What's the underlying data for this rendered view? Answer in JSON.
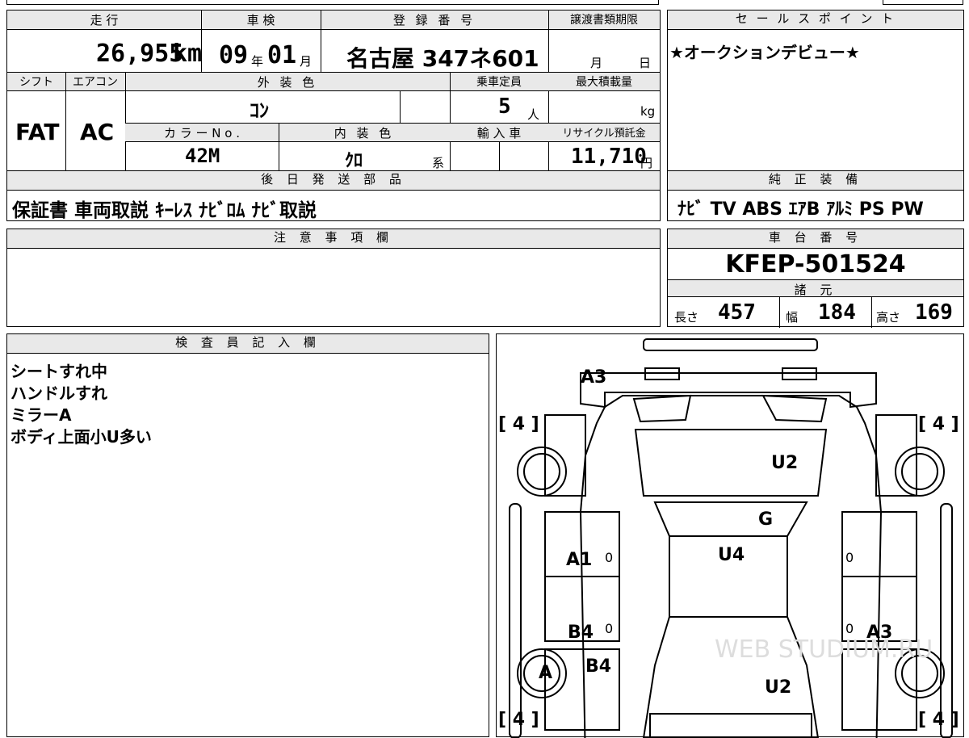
{
  "top_table": {
    "headers": {
      "mileage": "走 行",
      "inspection": "車 検",
      "registration": "登 録 番 号",
      "transfer_deadline": "譲渡書類期限",
      "shift": "シフト",
      "aircon": "エアコン",
      "exterior_color": "外 装 色",
      "capacity": "乗車定員",
      "max_load": "最大積載量",
      "color_no": "カ ラ ー N o .",
      "interior_color": "内 装 色",
      "import": "輸 入 車",
      "recycle_fee": "リサイクル預託金"
    },
    "mileage_value": "26,955",
    "mileage_unit": "km",
    "inspection_year": "09",
    "inspection_year_unit": "年",
    "inspection_month": "01",
    "inspection_month_unit": "月",
    "plate": "名古屋 347ネ601",
    "transfer_month_unit": "月",
    "transfer_day_unit": "日",
    "shift_value": "FAT",
    "aircon_value": "AC",
    "exterior_color_value": "ｺﾝ",
    "capacity_value": "5",
    "capacity_unit": "人",
    "max_load_unit": "kg",
    "color_no_value": "42M",
    "interior_color_value": "ｸﾛ",
    "interior_color_unit": "系",
    "recycle_fee_value": "11,710",
    "recycle_fee_unit": "円"
  },
  "sales_point": {
    "header": "セ ー ル ス ポ イ ン ト",
    "text": "★オークションデビュー★"
  },
  "later_parts": {
    "header": "後 日 発 送 部 品",
    "text": "保証書 車両取説 ｷｰﾚｽ ﾅﾋﾞﾛﾑ ﾅﾋﾞ取説"
  },
  "genuine_equipment": {
    "header": "純 正 装 備",
    "text": "ﾅﾋﾞ TV ABS ｴｱB ｱﾙﾐ PS PW"
  },
  "notes": {
    "header": "注 意 事 項 欄",
    "text": ""
  },
  "chassis": {
    "header": "車 台 番 号",
    "value": "KFEP-501524"
  },
  "specs": {
    "header": "諸 元",
    "length_label": "長さ",
    "length_value": "457",
    "width_label": "幅",
    "width_value": "184",
    "height_label": "高さ",
    "height_value": "169"
  },
  "inspector": {
    "header": "検 査 員 記 入 欄",
    "lines": [
      "シートすれ中",
      "ハンドルすれ",
      "ミラーA",
      "ボディ上面小U多い"
    ]
  },
  "diagram_marks": {
    "front_bumper": "A3",
    "bonnet": "U2",
    "windshield": "G",
    "roof": "U4",
    "front_left_door": "A1",
    "rear_left_door": "B4",
    "rear_left_fender": "B4",
    "rear_right_door": "A3",
    "rear_wheel_left": "A",
    "tailgate": "U2",
    "tire_fl": "[ 4 ]",
    "tire_fr": "[ 4 ]",
    "tire_rl": "[ 4 ]",
    "tire_rr": "[ 4 ]",
    "zero_1": "0",
    "zero_2": "0",
    "zero_3": "0",
    "zero_4": "0"
  },
  "watermark": "WEB STUDIUM.RU"
}
